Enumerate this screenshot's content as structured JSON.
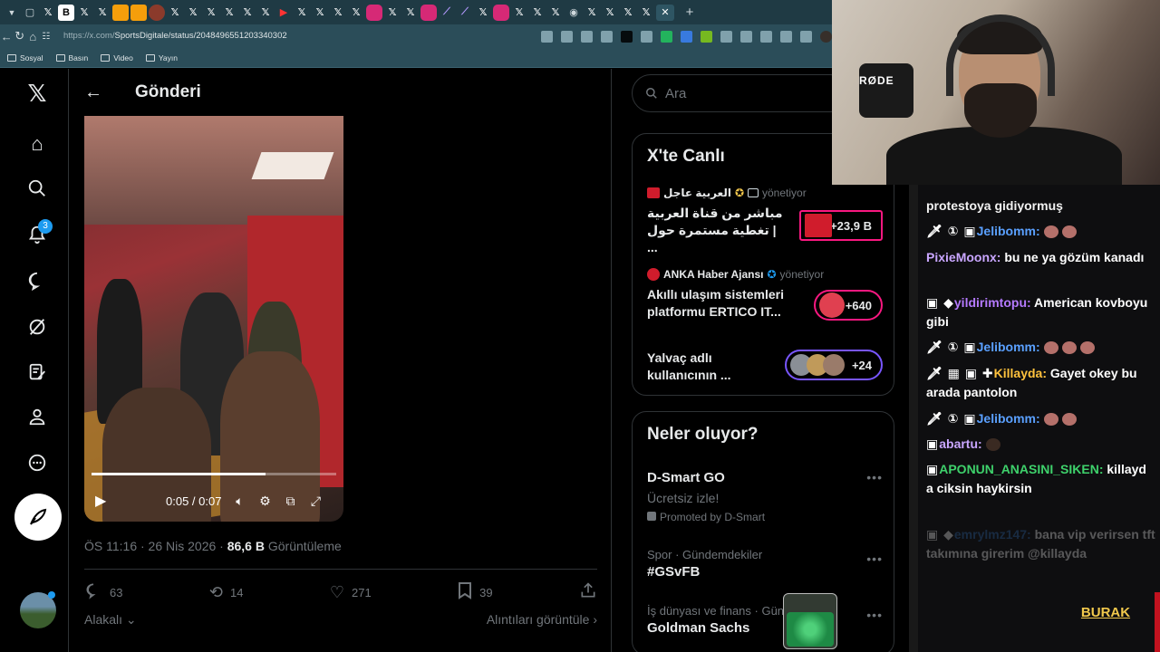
{
  "browser": {
    "url_domain": "https://x.com/",
    "url_path": "SportsDigitale/status/2048496551203340302",
    "bookmarks": [
      "Sosyal",
      "Basın",
      "Video",
      "Yayın"
    ]
  },
  "nav": {
    "notifications_badge": "3",
    "icons": [
      "x-logo-icon",
      "home-icon",
      "search-icon",
      "bell-icon",
      "message-icon",
      "grok-icon",
      "edit-list-icon",
      "profile-icon",
      "more-icon"
    ]
  },
  "post": {
    "header_title": "Gönderi",
    "video_time": "0:05 / 0:07",
    "video_progress": 0.71,
    "meta_date": "ÖS 11:16 · 26 Nis 2026 · ",
    "meta_views": "86,6 B",
    "meta_views_label": " Görüntüleme",
    "replies": "63",
    "reposts": "14",
    "likes": "271",
    "bookmarks": "39",
    "sort_label": "Alakalı",
    "quotes_link": "Alıntıları görüntüle"
  },
  "search": {
    "placeholder": "Ara"
  },
  "live": {
    "title": "X'te Canlı",
    "items": [
      {
        "source": "العربية عاجل",
        "status": "yönetiyor",
        "text": "مباشر من قناة العربية | تغطية مستمرة حول ...",
        "count": "+23,9 B"
      },
      {
        "source": "ANKA Haber Ajansı",
        "status": "yönetiyor",
        "text": "Akıllı ulaşım sistemleri platformu ERTICO IT...",
        "count": "+640"
      },
      {
        "source": "",
        "status": "",
        "text": "Yalvaç adlı kullanıcının ...",
        "count": "+24"
      }
    ]
  },
  "trends": {
    "title": "Neler oluyor?",
    "items": [
      {
        "category": "",
        "name": "D-Smart GO",
        "sub": "Ücretsiz izle!",
        "promo": "Promoted by D-Smart"
      },
      {
        "category": "Spor · Gündemdekiler",
        "name": "#GSvFB",
        "sub": "",
        "promo": ""
      },
      {
        "category": "İş dünyası ve finans · Gün",
        "name": "Goldman Sachs",
        "sub": "",
        "promo": ""
      }
    ]
  },
  "stream": {
    "mic_brand": "RØDE",
    "brand": "BURAK",
    "chat": [
      {
        "user": "",
        "text": "protestoya gidiyormuş",
        "color": "#ffffff"
      },
      {
        "user": "Jelibomm:",
        "text": "",
        "color": "#5aa0ff"
      },
      {
        "user": "PixieMoonx:",
        "text": "bu ne ya gözüm kanadı",
        "color": "#c9a6ff"
      },
      {
        "user": "yildirimtopu:",
        "text": "American kovboyu gibi",
        "color": "#b57aff"
      },
      {
        "user": "Jelibomm:",
        "text": "",
        "color": "#5aa0ff"
      },
      {
        "user": "Killayda:",
        "text": "Gayet okey bu arada pantolon",
        "color": "#ffc23d"
      },
      {
        "user": "Jelibomm:",
        "text": "",
        "color": "#5aa0ff"
      },
      {
        "user": "abartu:",
        "text": "",
        "color": "#c9a6ff"
      },
      {
        "user": "APONUN_ANASINI_SIKEN:",
        "text": "killayd a ciksin haykirsin",
        "color": "#3ed16b"
      },
      {
        "user": "emrylmz147:",
        "text": "bana vip verirsen tft takımına girerim @killayda",
        "color": "#2f6db3"
      }
    ]
  }
}
